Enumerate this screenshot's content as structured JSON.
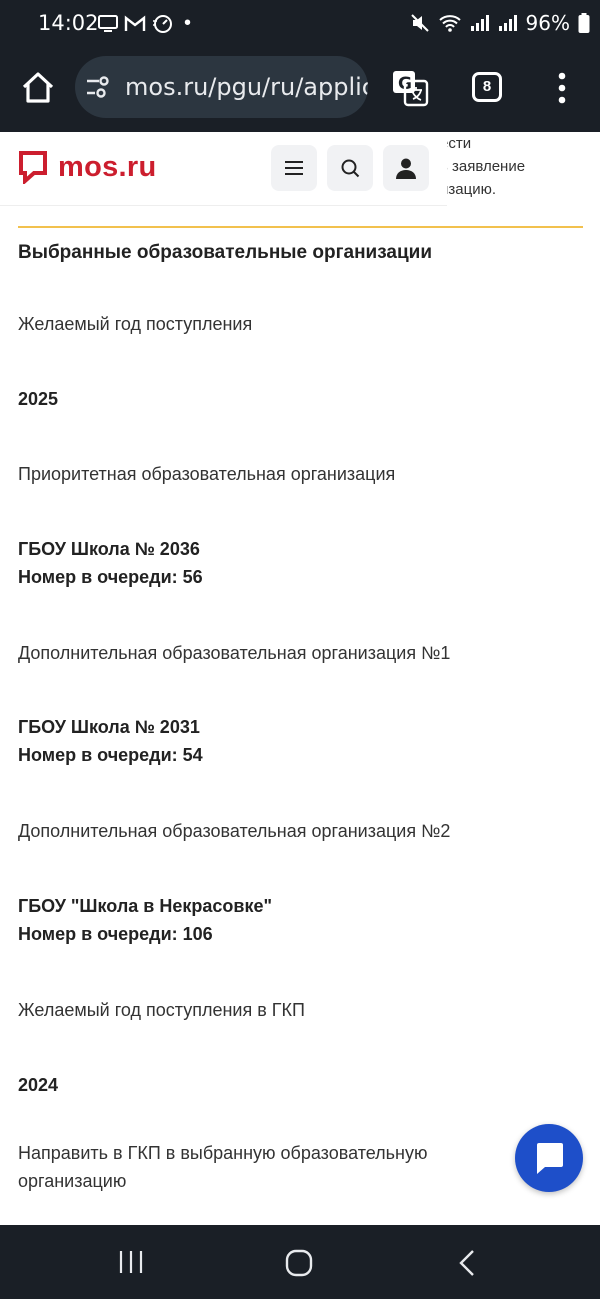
{
  "status_bar": {
    "time": "14:02",
    "dot": "•",
    "battery": "96%",
    "icons": [
      "screen-cast-icon",
      "gmail-icon",
      "speed-icon",
      "mute-icon",
      "wifi-icon",
      "signal-icon",
      "battery-icon"
    ]
  },
  "browser": {
    "url": "mos.ru/pgu/ru/application",
    "tab_count": "8"
  },
  "background_text": {
    "line1": "ести",
    "line2": "ь заявление",
    "line3": "изацию."
  },
  "site": {
    "logo_text": "mos.ru",
    "brand_color": "#cc1e2e"
  },
  "content": {
    "section_title": "Выбранные образовательные организации",
    "desired_year_label": "Желаемый год поступления",
    "desired_year_value": "2025",
    "priority_org_label": "Приоритетная образовательная организация",
    "priority_org_name": "ГБОУ Школа № 2036",
    "priority_org_queue": "Номер в очереди: 56",
    "additional_org1_label": "Дополнительная образовательная организация №1",
    "additional_org1_name": "ГБОУ Школа № 2031",
    "additional_org1_queue": "Номер в очереди: 54",
    "additional_org2_label": "Дополнительная образовательная организация №2",
    "additional_org2_name": "ГБОУ \"Школа в Некрасовке\"",
    "additional_org2_queue": "Номер в очереди: 106",
    "gkp_year_label": "Желаемый год поступления в ГКП",
    "gkp_year_value": "2024",
    "gkp_direct_label_line1": "Направить в ГКП в выбранную образовательную",
    "gkp_direct_label_line2": "организацию"
  }
}
